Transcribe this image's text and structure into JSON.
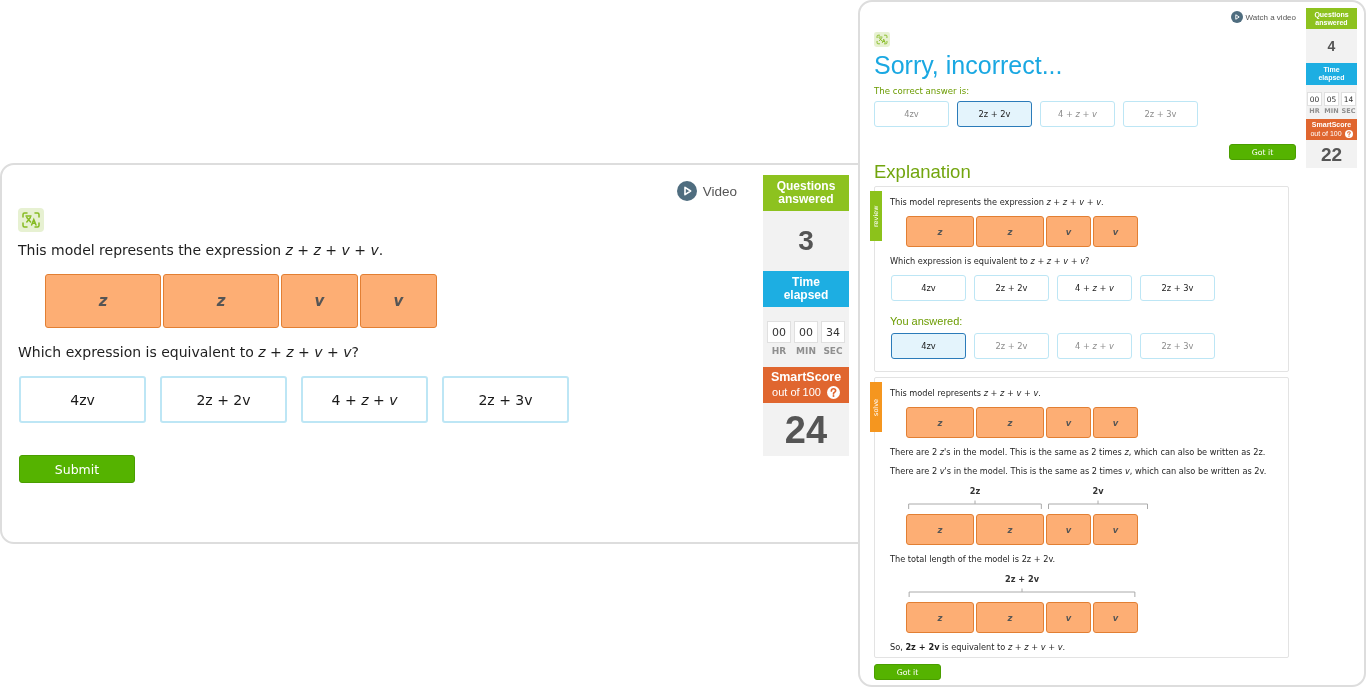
{
  "question_screen": {
    "video_link": "Video",
    "prompt": "This model represents the expression *z* + *z* + *v* + *v*.",
    "model": {
      "groups": [
        {
          "blocks": [
            {
              "label": "z",
              "kind": "long"
            },
            {
              "label": "z",
              "kind": "long"
            },
            {
              "label": "v",
              "kind": "short"
            },
            {
              "label": "v",
              "kind": "short"
            }
          ]
        }
      ]
    },
    "question": "Which expression is equivalent to *z* + *z* + *v* + *v*?",
    "choices": [
      {
        "label": "4zv",
        "selected": false
      },
      {
        "label": "2z + 2v",
        "selected": false
      },
      {
        "label": "4 + *z* + *v*",
        "selected": false
      },
      {
        "label": "2z + 3v",
        "selected": false
      }
    ],
    "submit_button": "Submit",
    "stats": {
      "questions_answered": {
        "title": "Questions answered",
        "value": "3"
      },
      "time_elapsed": {
        "title": "Time elapsed",
        "parts": [
          {
            "value": "00",
            "unit": "HR"
          },
          {
            "value": "00",
            "unit": "MIN"
          },
          {
            "value": "34",
            "unit": "SEC"
          }
        ]
      },
      "smart_score": {
        "title": "SmartScore",
        "subtitle": "out of 100",
        "value": "24"
      }
    }
  },
  "feedback_screen": {
    "video_link": "Watch a video",
    "heading": "Sorry, incorrect...",
    "correct_label": "The correct answer is:",
    "correct_choices": [
      {
        "label": "4zv",
        "selected": false,
        "disabled": true
      },
      {
        "label": "2z + 2v",
        "selected": true,
        "disabled": false
      },
      {
        "label": "4 + *z* + *v*",
        "selected": false,
        "disabled": true
      },
      {
        "label": "2z + 3v",
        "selected": false,
        "disabled": true
      }
    ],
    "got_it_button": "Got it",
    "explanation_heading": "Explanation",
    "sections": [
      {
        "tag": "review",
        "kind": "review",
        "items": [
          {
            "kind": "text",
            "text": "This model represents the expression *z* + *z* + *v* + *v*."
          },
          {
            "kind": "model",
            "groups": [
              {
                "blocks": [
                  {
                    "label": "z",
                    "kind": "long"
                  },
                  {
                    "label": "z",
                    "kind": "long"
                  },
                  {
                    "label": "v",
                    "kind": "short"
                  },
                  {
                    "label": "v",
                    "kind": "short"
                  }
                ]
              }
            ]
          },
          {
            "kind": "text",
            "text": "Which expression is equivalent to *z* + *z* + *v* + *v*?"
          },
          {
            "kind": "choices",
            "choices": [
              {
                "label": "4zv",
                "selected": false,
                "disabled": false
              },
              {
                "label": "2z + 2v",
                "selected": false,
                "disabled": false
              },
              {
                "label": "4 + *z* + *v*",
                "selected": false,
                "disabled": false
              },
              {
                "label": "2z + 3v",
                "selected": false,
                "disabled": false
              }
            ]
          },
          {
            "kind": "label",
            "text": "You answered:"
          },
          {
            "kind": "choices",
            "choices": [
              {
                "label": "4zv",
                "selected": true,
                "disabled": false
              },
              {
                "label": "2z + 2v",
                "selected": false,
                "disabled": true
              },
              {
                "label": "4 + *z* + *v*",
                "selected": false,
                "disabled": true
              },
              {
                "label": "2z + 3v",
                "selected": false,
                "disabled": true
              }
            ]
          }
        ]
      },
      {
        "tag": "solve",
        "kind": "solve",
        "items": [
          {
            "kind": "text",
            "text": "This model represents *z* + *z* + *v* + *v*."
          },
          {
            "kind": "model",
            "groups": [
              {
                "blocks": [
                  {
                    "label": "z",
                    "kind": "long"
                  },
                  {
                    "label": "z",
                    "kind": "long"
                  },
                  {
                    "label": "v",
                    "kind": "short"
                  },
                  {
                    "label": "v",
                    "kind": "short"
                  }
                ]
              }
            ]
          },
          {
            "kind": "text",
            "text": "There are 2 *z*'s in the model. This is the same as 2 times *z*, which can also be written as 2z."
          },
          {
            "kind": "text",
            "text": "There are 2 *v*'s in the model. This is the same as 2 times *v*, which can also be written as 2v."
          },
          {
            "kind": "model",
            "groups": [
              {
                "label": "2z",
                "blocks": [
                  {
                    "label": "z",
                    "kind": "long"
                  },
                  {
                    "label": "z",
                    "kind": "long"
                  }
                ]
              },
              {
                "label": "2v",
                "blocks": [
                  {
                    "label": "v",
                    "kind": "short"
                  },
                  {
                    "label": "v",
                    "kind": "short"
                  }
                ]
              }
            ]
          },
          {
            "kind": "text",
            "text": "The total length of the model is 2z + 2v."
          },
          {
            "kind": "model",
            "groups": [
              {
                "label": "2z + 2v",
                "blocks": [
                  {
                    "label": "z",
                    "kind": "long"
                  },
                  {
                    "label": "z",
                    "kind": "long"
                  },
                  {
                    "label": "v",
                    "kind": "short"
                  },
                  {
                    "label": "v",
                    "kind": "short"
                  }
                ]
              }
            ]
          },
          {
            "kind": "text",
            "text": "So, **2z + 2v** is equivalent to *z* + *z* + *v* + *v*."
          }
        ]
      }
    ],
    "bottom_button": "Got it",
    "stats": {
      "questions_answered": {
        "title": "Questions answered",
        "value": "4"
      },
      "time_elapsed": {
        "title": "Time elapsed",
        "parts": [
          {
            "value": "00",
            "unit": "HR"
          },
          {
            "value": "05",
            "unit": "MIN"
          },
          {
            "value": "14",
            "unit": "SEC"
          }
        ]
      },
      "smart_score": {
        "title": "SmartScore",
        "subtitle": "out of 100",
        "value": "22"
      }
    }
  }
}
